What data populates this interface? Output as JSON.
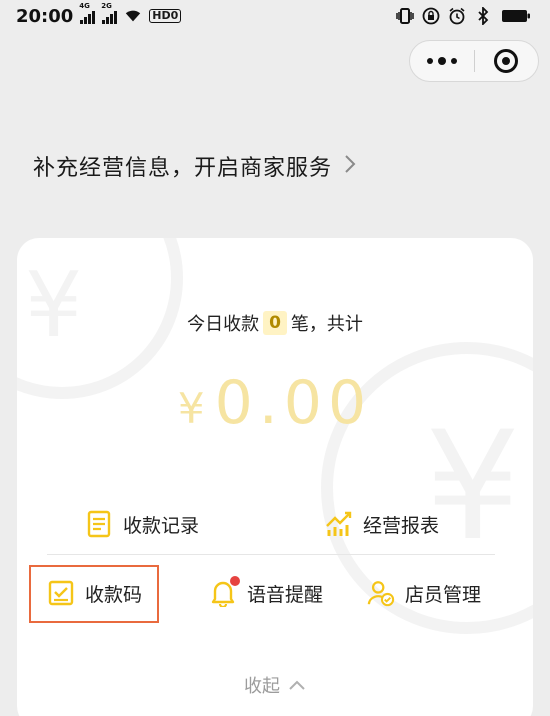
{
  "status_bar": {
    "time": "20:00",
    "signal_1_tag": "4G",
    "signal_2_tag": "2G",
    "hd_badge": "HD",
    "hd_number": "0",
    "icons": [
      "vibrate-icon",
      "lock-rotation-icon",
      "alarm-icon",
      "bluetooth-icon",
      "battery-icon"
    ]
  },
  "capsule": {
    "icons": [
      "more-dots-icon",
      "close-target-icon"
    ]
  },
  "merchant_banner": {
    "text": "补充经营信息，开启商家服务"
  },
  "card": {
    "today_prefix": "今日收款",
    "today_count": "0",
    "today_suffix": "笔，共计",
    "currency": "¥",
    "amount": "0.00",
    "actions": [
      {
        "label": "收款记录",
        "icon": "document-icon"
      },
      {
        "label": "经营报表",
        "icon": "chart-icon"
      },
      {
        "label": "收款码",
        "icon": "qr-receipt-icon"
      },
      {
        "label": "语音提醒",
        "icon": "bell-icon"
      },
      {
        "label": "店员管理",
        "icon": "staff-icon"
      }
    ],
    "collapse_label": "收起"
  },
  "colors": {
    "accent_yellow": "#f5c518",
    "amount_faded": "#f6e4a2",
    "highlight_border": "#e96a3e",
    "badge_red": "#e64340",
    "page_bg": "#ededed"
  }
}
